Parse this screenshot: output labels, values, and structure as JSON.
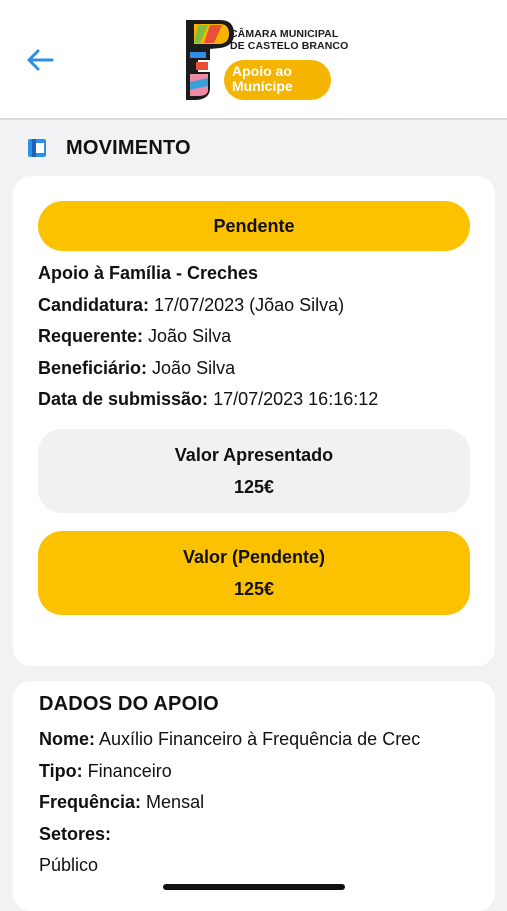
{
  "header": {
    "back_icon": "arrow-left-icon",
    "logo_line1": "CÂMARA MUNICIPAL",
    "logo_line2": "DE CASTELO BRANCO",
    "logo_pill_line1": "Apoio ao",
    "logo_pill_line2": "Munícipe",
    "colors": {
      "accent": "#2f8ee8",
      "logo_orange": "#f5b400"
    }
  },
  "section": {
    "icon": "document-icon",
    "title": "MOVIMENTO"
  },
  "movement": {
    "status": "Pendente",
    "type": "Apoio à Família - Creches",
    "candidatura_label": "Candidatura:",
    "candidatura_value": "17/07/2023 (Jõao Silva)",
    "requerente_label": "Requerente:",
    "requerente_value": "João Silva",
    "beneficiario_label": "Beneficiário:",
    "beneficiario_value": "João Silva",
    "data_label": "Data de submissão:",
    "data_value": "17/07/2023 16:16:12",
    "valor_apresentado_label": "Valor Apresentado",
    "valor_apresentado": "125€",
    "valor_pendente_label": "Valor (Pendente)",
    "valor_pendente": "125€",
    "colors": {
      "status_yellow": "#fcc200",
      "grey_box": "#f1f1f3"
    }
  },
  "dados": {
    "title": "DADOS DO APOIO",
    "nome_label": "Nome:",
    "nome_value": "Auxílio Financeiro à Frequência de Crec",
    "tipo_label": "Tipo:",
    "tipo_value": "Financeiro",
    "frequencia_label": "Frequência:",
    "frequencia_value": "Mensal",
    "setores_label": "Setores:",
    "setores_value": "Público"
  }
}
